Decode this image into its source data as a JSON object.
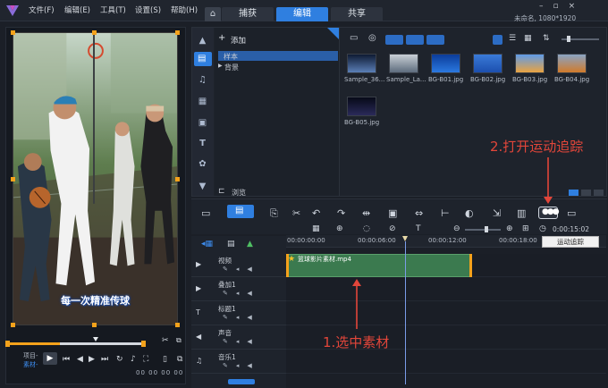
{
  "menu": {
    "file": "文件(F)",
    "edit": "编辑(E)",
    "tools": "工具(T)",
    "settings": "设置(S)",
    "help": "帮助(H)"
  },
  "tabs": [
    {
      "label": "捕获"
    },
    {
      "label": "编辑",
      "active": true
    },
    {
      "label": "共享"
    }
  ],
  "window": {
    "project_name": "未命名, 1080*1920"
  },
  "preview": {
    "caption": "每一次精准传球",
    "mode_project": "项目-",
    "mode_clip": "素材-",
    "timecode": "00 00 00 00"
  },
  "library": {
    "add_label": "添加",
    "folders": [
      {
        "label": "样本",
        "selected": true
      },
      {
        "label": "背景"
      }
    ],
    "browse_label": "浏览",
    "items": [
      {
        "label": "Sample_36...",
        "colors": [
          "#0e1a33",
          "#5b7fb7"
        ]
      },
      {
        "label": "Sample_La...",
        "colors": [
          "#c9cfd6",
          "#5d6c7d"
        ]
      },
      {
        "label": "BG-B01.jpg",
        "colors": [
          "#0b3d9a",
          "#2b79e0"
        ]
      },
      {
        "label": "BG-B02.jpg",
        "colors": [
          "#3a7ad8",
          "#1c4fae"
        ]
      },
      {
        "label": "BG-B03.jpg",
        "colors": [
          "#5f9be8",
          "#e9a341"
        ]
      },
      {
        "label": "BG-B04.jpg",
        "colors": [
          "#8aa4c4",
          "#d17a2a"
        ]
      },
      {
        "label": "BG-B05.jpg",
        "colors": [
          "#070a18",
          "#2a2a5a"
        ]
      }
    ]
  },
  "timeline": {
    "ruler": [
      "00:00:00:00",
      "00:00:06:00",
      "00:00:12:00",
      "00:00:18:00"
    ],
    "timecode": "0:00:15:02",
    "tracks": [
      {
        "label": "视频"
      },
      {
        "label": "叠加1"
      },
      {
        "label": "标题1"
      },
      {
        "label": "声音"
      },
      {
        "label": "音乐1"
      }
    ],
    "clip_name": "篮球影片素材.mp4",
    "motion_tooltip": "运动追踪"
  },
  "annotations": {
    "step1": "1.选中素材",
    "step2": "2.打开运动追踪",
    "color": "#e2463a"
  }
}
